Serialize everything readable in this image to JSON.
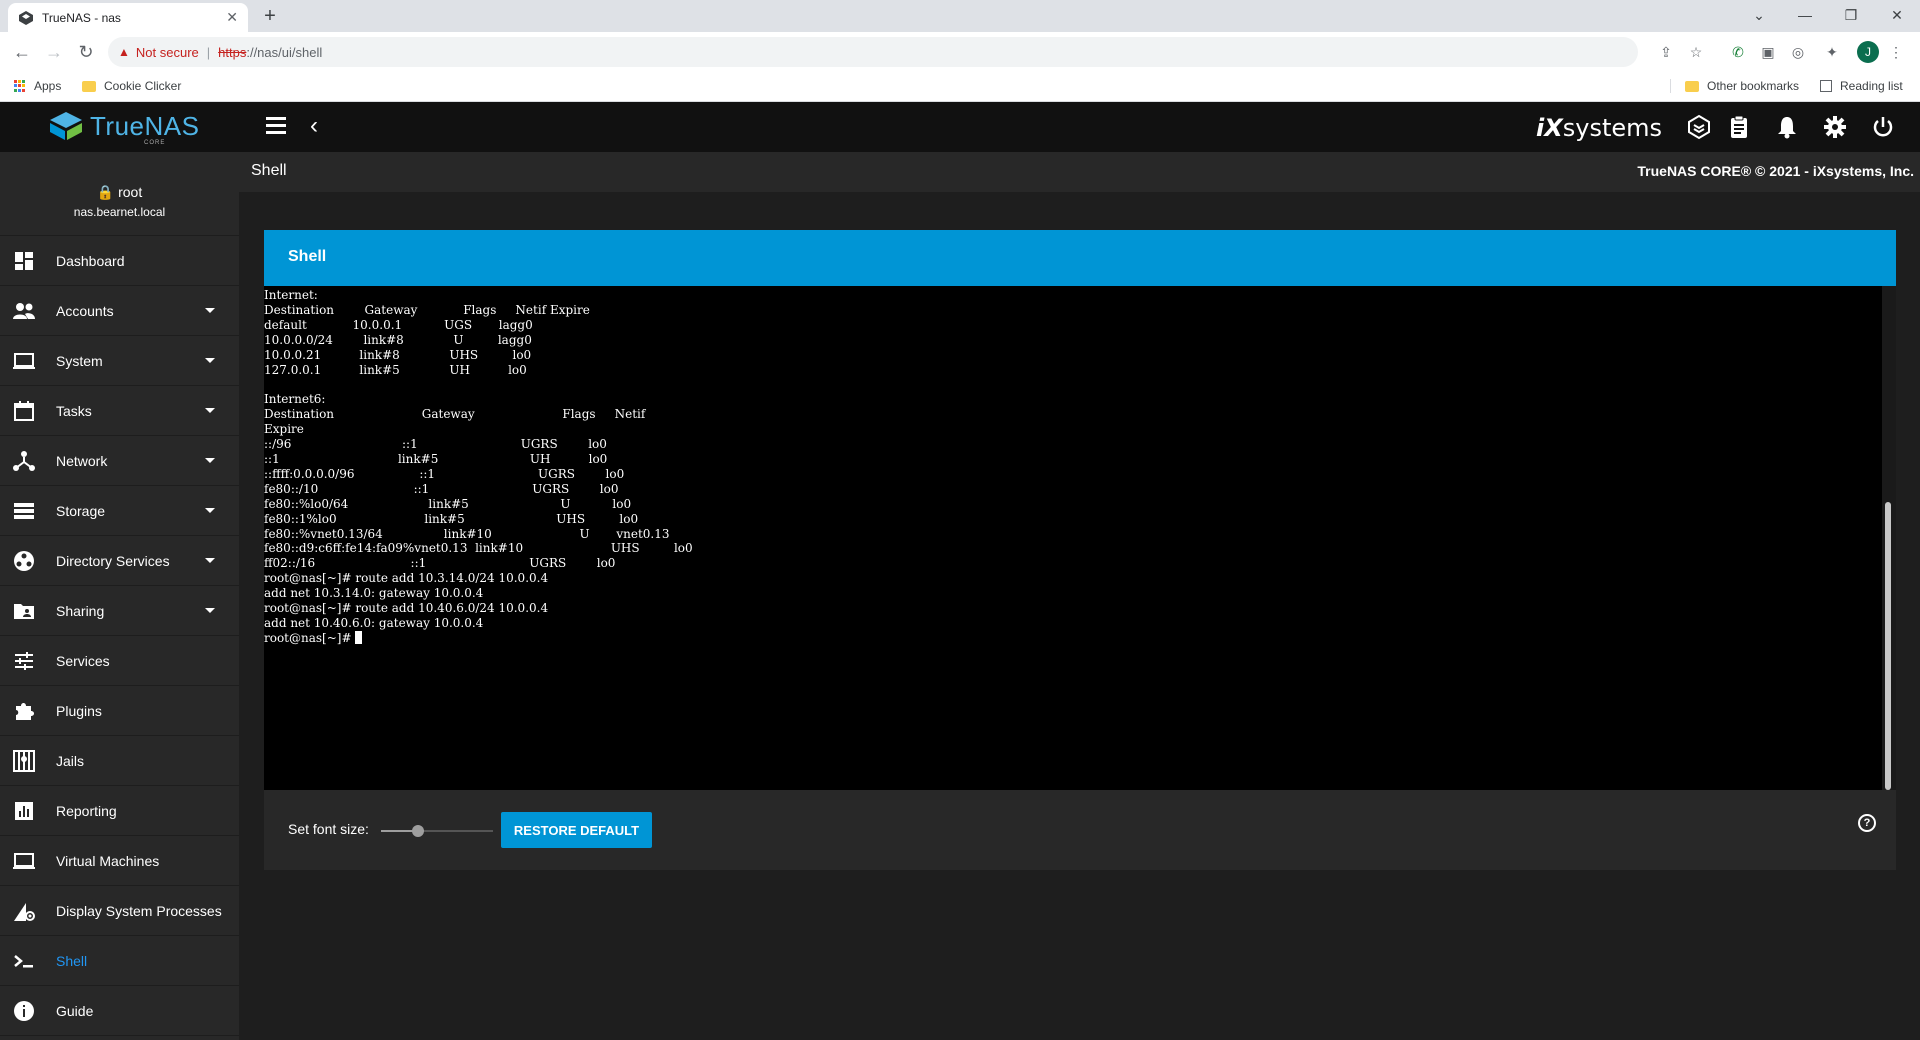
{
  "browser": {
    "tab_title": "TrueNAS - nas",
    "tab_close": "✕",
    "new_tab": "+",
    "win_minimize": "—",
    "win_maximize": "❐",
    "win_close": "✕",
    "security_label": "Not secure",
    "url_scheme": "https",
    "url_rest": "://nas/ui/shell",
    "avatar_letter": "J",
    "bookmarks": {
      "apps": "Apps",
      "cookie": "Cookie Clicker",
      "other": "Other bookmarks",
      "reading": "Reading list"
    }
  },
  "header": {
    "logo_text": "TrueNAS",
    "logo_sub": "CORE",
    "brand": "systems"
  },
  "sidebar": {
    "user": "root",
    "host": "nas.bearnet.local",
    "items": [
      {
        "label": "Dashboard",
        "icon": "dashboard-icon"
      },
      {
        "label": "Accounts",
        "icon": "people-icon"
      },
      {
        "label": "System",
        "icon": "laptop-icon"
      },
      {
        "label": "Tasks",
        "icon": "calendar-icon"
      },
      {
        "label": "Network",
        "icon": "network-icon"
      },
      {
        "label": "Storage",
        "icon": "storage-icon"
      },
      {
        "label": "Directory Services",
        "icon": "directory-icon"
      },
      {
        "label": "Sharing",
        "icon": "folder-shared-icon"
      },
      {
        "label": "Services",
        "icon": "tune-icon"
      },
      {
        "label": "Plugins",
        "icon": "puzzle-icon"
      },
      {
        "label": "Jails",
        "icon": "jail-icon"
      },
      {
        "label": "Reporting",
        "icon": "chart-icon"
      },
      {
        "label": "Virtual Machines",
        "icon": "vm-icon"
      },
      {
        "label": "Display System Processes",
        "icon": "processes-icon"
      },
      {
        "label": "Shell",
        "icon": "shell-icon"
      },
      {
        "label": "Guide",
        "icon": "info-icon"
      }
    ]
  },
  "page": {
    "title": "Shell",
    "copyright": "TrueNAS CORE® © 2021 - iXsystems, Inc."
  },
  "card": {
    "title": "Shell",
    "terminal_lines": [
      "Internet:",
      "Destination        Gateway            Flags     Netif Expire",
      "default            10.0.0.1           UGS       lagg0",
      "10.0.0.0/24        link#8             U         lagg0",
      "10.0.0.21          link#8             UHS         lo0",
      "127.0.0.1          link#5             UH          lo0",
      "",
      "Internet6:",
      "Destination                       Gateway                       Flags     Netif",
      "Expire",
      "::/96                             ::1                           UGRS        lo0",
      "::1                               link#5                        UH          lo0",
      "::ffff:0.0.0.0/96                 ::1                           UGRS        lo0",
      "fe80::/10                         ::1                           UGRS        lo0",
      "fe80::%lo0/64                     link#5                        U           lo0",
      "fe80::1%lo0                       link#5                        UHS         lo0",
      "fe80::%vnet0.13/64                link#10                       U       vnet0.13",
      "fe80::d9:c6ff:fe14:fa09%vnet0.13  link#10                       UHS         lo0",
      "ff02::/16                         ::1                           UGRS        lo0",
      "root@nas[~]# route add 10.3.14.0/24 10.0.0.4",
      "add net 10.3.14.0: gateway 10.0.0.4",
      "root@nas[~]# route add 10.40.6.0/24 10.0.0.4",
      "add net 10.40.6.0: gateway 10.0.0.4"
    ],
    "prompt": "root@nas[~]# ",
    "font_size_label": "Set font size:",
    "font_size_level": 0.33,
    "restore_label": "RESTORE DEFAULT",
    "help": "?"
  },
  "colors": {
    "accent": "#0095d5",
    "active_nav": "#2196f3",
    "sidebar_bg": "#282828",
    "header_bg": "#111111"
  }
}
